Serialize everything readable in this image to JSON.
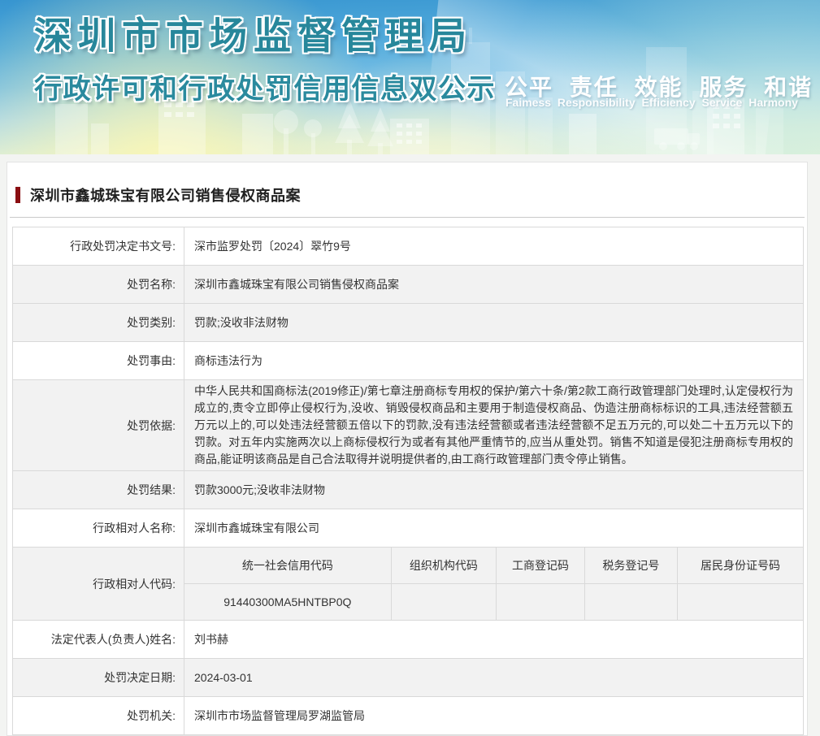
{
  "banner": {
    "title": "深圳市市场监督管理局",
    "subtitle": "行政许可和行政处罚信用信息双公示",
    "slogan_cn": "公平 责任 效能 服务 和谐",
    "slogan_en": "Faimess Responsibility Efficiency Service Harmony"
  },
  "page": {
    "case_title": "深圳市鑫城珠宝有限公司销售侵权商品案"
  },
  "table": {
    "rows": [
      {
        "label": "行政处罚决定书文号:",
        "value": "深市监罗处罚〔2024〕翠竹9号"
      },
      {
        "label": "处罚名称:",
        "value": "深圳市鑫城珠宝有限公司销售侵权商品案"
      },
      {
        "label": "处罚类别:",
        "value": "罚款;没收非法财物"
      },
      {
        "label": "处罚事由:",
        "value": "商标违法行为"
      },
      {
        "label": "处罚依据:",
        "value": "中华人民共和国商标法(2019修正)/第七章注册商标专用权的保护/第六十条/第2款工商行政管理部门处理时,认定侵权行为成立的,责令立即停止侵权行为,没收、销毁侵权商品和主要用于制造侵权商品、伪造注册商标标识的工具,违法经营额五万元以上的,可以处违法经营额五倍以下的罚款,没有违法经营额或者违法经营额不足五万元的,可以处二十五万元以下的罚款。对五年内实施两次以上商标侵权行为或者有其他严重情节的,应当从重处罚。销售不知道是侵犯注册商标专用权的商品,能证明该商品是自己合法取得并说明提供者的,由工商行政管理部门责令停止销售。"
      },
      {
        "label": "处罚结果:",
        "value": "罚款3000元;没收非法财物"
      },
      {
        "label": "行政相对人名称:",
        "value": "深圳市鑫城珠宝有限公司"
      },
      {
        "label": "行政相对人代码:",
        "columns": [
          "统一社会信用代码",
          "组织机构代码",
          "工商登记码",
          "税务登记号",
          "居民身份证号码"
        ],
        "values": [
          "91440300MA5HNTBP0Q",
          "",
          "",
          "",
          ""
        ]
      },
      {
        "label": "法定代表人(负责人)姓名:",
        "value": "刘书赫"
      },
      {
        "label": "处罚决定日期:",
        "value": "2024-03-01"
      },
      {
        "label": "处罚机关:",
        "value": "深圳市市场监督管理局罗湖监管局"
      }
    ]
  },
  "colors": {
    "banner_text": "#27879b",
    "title_marker": "#8a0e12",
    "row_shade": "#f2f2f2",
    "table_border": "#d9d9d9"
  }
}
